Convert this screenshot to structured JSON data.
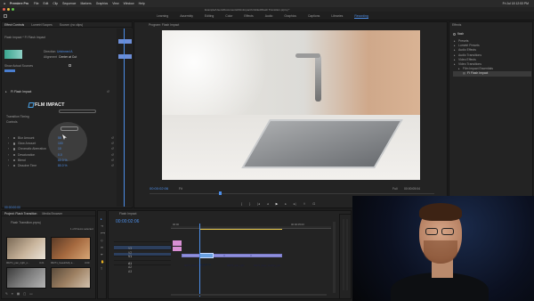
{
  "mac_menubar": {
    "app_name": "Premiere Pro",
    "menus": [
      "File",
      "Edit",
      "Clip",
      "Sequence",
      "Markers",
      "Graphics",
      "View",
      "Window",
      "Help"
    ],
    "clock": "Fri Jul 18  12:53 PM"
  },
  "app_title": "Example/Users/Documents/FilmImpact/Untitled/Flash Transition.prproj *",
  "workspaces": [
    "Learning",
    "Assembly",
    "Editing",
    "Color",
    "Effects",
    "Audio",
    "Graphics",
    "Captions",
    "Libraries",
    "Recording"
  ],
  "active_workspace": "Recording",
  "effect_controls": {
    "tabs": [
      "Effect Controls",
      "Lumetri Scopes",
      "Source: (no clips)"
    ],
    "header": "Flash Impact * FI Flash Impact",
    "direction_label": "Direction",
    "direction_value": "Unbinned A",
    "alignment_label": "Alignment",
    "alignment_value": "Center at Cut",
    "show_actual_sources": "Show Actual Sources",
    "section_title": "FI Flash Impact",
    "logo_text": "FLM IMPACT",
    "transition_timing": "Transition Timing",
    "controls_label": "Controls",
    "params": [
      {
        "name": "Blur Amount",
        "value": "55"
      },
      {
        "name": "Glow Amount",
        "value": "100"
      },
      {
        "name": "Chromatic Aberration",
        "value": "10"
      },
      {
        "name": "Desaturation",
        "value": "0.0"
      },
      {
        "name": "Blend",
        "value": "80.0 %"
      },
      {
        "name": "Dissolve Time",
        "value": "80.0 %"
      }
    ],
    "timecode": "00:00:00:00"
  },
  "program_monitor": {
    "title": "Program: Flash Impact",
    "timecode_in": "00:00:02:06",
    "fit": "Fit",
    "quality": "Full",
    "duration": "00:00:05:04"
  },
  "effects_panel": {
    "title": "Effects",
    "search_placeholder": "flash",
    "tree": [
      "Presets",
      "Lumetri Presets",
      "Audio Effects",
      "Audio Transitions",
      "Video Effects",
      "Video Transitions",
      "Film Impact Essentials",
      "FI Flash Impact"
    ]
  },
  "project_panel": {
    "tabs": [
      "Project: Flash Transition",
      "Media Browser"
    ],
    "path": "Flash Transition.prproj",
    "item_count": "1 of 8 items selected",
    "thumbnails": [
      {
        "name": "06271_pan_right_s...",
        "duration": "4:21"
      },
      {
        "name": "06271_beautifully a...",
        "duration": "4:00"
      },
      {
        "name": "",
        "duration": ""
      },
      {
        "name": "",
        "duration": ""
      }
    ]
  },
  "timeline": {
    "tab": "Flash Impact",
    "timecode": "00:00:02:06",
    "ruler_left": "00:00",
    "ruler_right": "00:00:05:00",
    "tracks_video": [
      "V3",
      "V2",
      "V1"
    ],
    "tracks_audio": [
      "A1",
      "A2",
      "A3"
    ],
    "clips": [
      {
        "label": "06271_beautifully_s",
        "track": "V1"
      },
      {
        "label": "06271_pan_right",
        "track": "V1"
      },
      {
        "label": "06271_large_cooking_pot",
        "track": "V1"
      }
    ],
    "transition_label": "FI Flash Im"
  },
  "colors": {
    "accent_blue": "#4d8ee8",
    "clip_purple": "#8f8fdc",
    "audio_pink": "#d88fd4",
    "marker_yellow": "#e8c84a"
  }
}
